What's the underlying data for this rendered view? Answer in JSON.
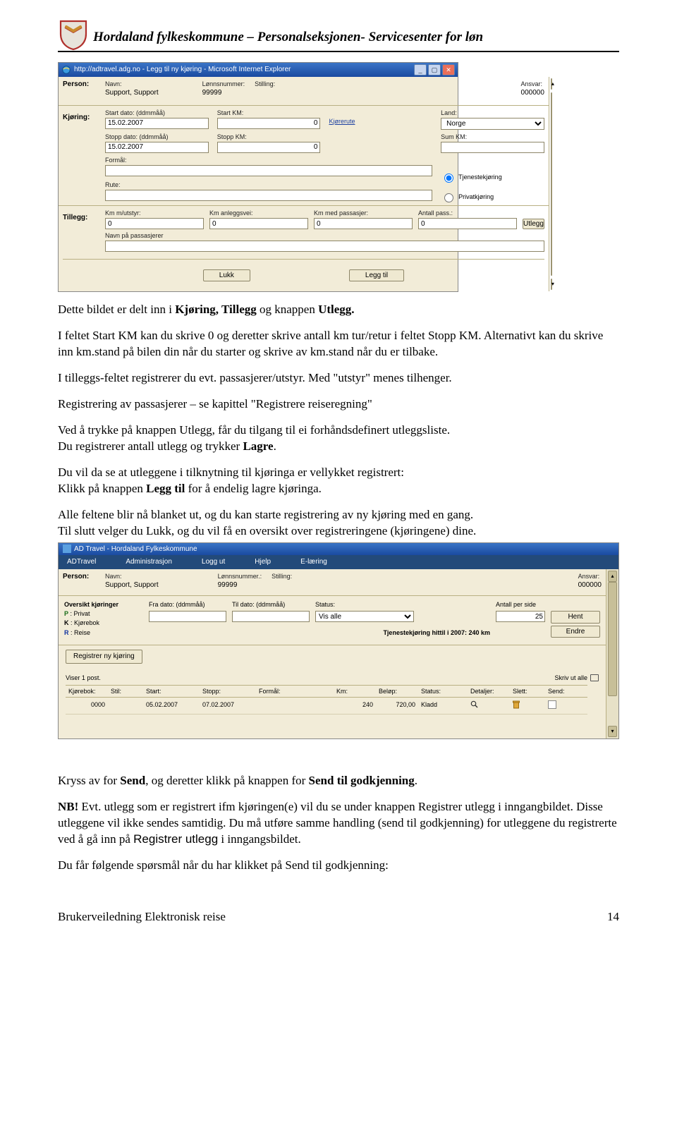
{
  "header": {
    "org_title": "Hordaland fylkeskommune – Personalseksjonen- Servicesenter for løn"
  },
  "ss1": {
    "title": "http://adtravel.adg.no - Legg til ny kjøring - Microsoft Internet Explorer",
    "person": {
      "label": "Person:",
      "navn_label": "Navn:",
      "navn_val": "Support, Support",
      "lonnsnr_label": "Lønnsnummer:",
      "lonnsnr_val": "99999",
      "stilling_label": "Stilling:",
      "stilling_val": "",
      "ansvar_label": "Ansvar:",
      "ansvar_val": "000000"
    },
    "kjoring": {
      "label": "Kjøring:",
      "start_dato_label": "Start dato: (ddmmåå)",
      "start_dato_val": "15.02.2007",
      "start_km_label": "Start KM:",
      "start_km_val": "0",
      "kjorerute_link": "Kjørerute",
      "land_label": "Land:",
      "land_val": "Norge",
      "stopp_dato_label": "Stopp dato: (ddmmåå)",
      "stopp_dato_val": "15.02.2007",
      "stopp_km_label": "Stopp KM:",
      "stopp_km_val": "0",
      "sum_km_label": "Sum KM:",
      "sum_km_val": "",
      "formal_label": "Formål:",
      "rute_label": "Rute:",
      "tjeneste_label": "Tjenestekjøring",
      "privat_label": "Privatkjøring"
    },
    "tillegg": {
      "label": "Tillegg:",
      "km_utstyr_label": "Km m/utstyr:",
      "km_utstyr_val": "0",
      "km_anlegg_label": "Km anleggsvei:",
      "km_anlegg_val": "0",
      "km_pass_label": "Km med passasjer:",
      "km_pass_val": "0",
      "antall_pass_label": "Antall pass.:",
      "antall_pass_val": "0",
      "utlegg_btn": "Utlegg",
      "navn_pass_label": "Navn på passasjerer"
    },
    "buttons": {
      "lukk": "Lukk",
      "legg_til": "Legg til"
    }
  },
  "body": {
    "p1a": "Dette bildet er delt inn i ",
    "p1b": "Kjøring, Tillegg",
    "p1c": " og knappen ",
    "p1d": "Utlegg.",
    "p2": "I feltet Start KM kan du skrive 0 og deretter skrive antall km tur/retur i feltet Stopp KM. Alternativt kan du skrive inn km.stand på bilen din når du starter og skrive av km.stand når du er tilbake.",
    "p3": "I tilleggs-feltet registrerer du evt. passasjerer/utstyr. Med \"utstyr\" menes tilhenger.",
    "p4": "Registrering av passasjerer – se kapittel \"Registrere reiseregning\"",
    "p5a": "Ved å trykke på knappen Utlegg, får du tilgang til ei forhåndsdefinert utleggsliste.",
    "p5b": "Du registrerer antall utlegg og trykker ",
    "p5c": "Lagre",
    "p5d": ".",
    "p6a": "Du vil da se at utleggene i tilknytning til kjøringa er vellykket registrert:",
    "p6b": "Klikk på knappen ",
    "p6c": "Legg til",
    "p6d": " for å endelig lagre kjøringa.",
    "p7a": "Alle feltene blir nå blanket ut, og du kan starte registrering av ny kjøring med en gang.",
    "p7b": "Til slutt velger du Lukk, og du vil få en oversikt over registreringene (kjøringene) dine.",
    "p8a": "Kryss av for ",
    "p8b": "Send",
    "p8c": ", og deretter klikk på knappen for ",
    "p8d": "Send til godkjenning",
    "p8e": ".",
    "p9a": "NB!",
    "p9b": " Evt. utlegg som er registrert ifm kjøringen(e) vil du se under knappen Registrer utlegg i inngangbildet. Disse utleggene vil ikke sendes samtidig. Du må utføre samme handling (send til godkjenning) for utleggene du registrerte ved å gå inn på ",
    "p9c": "Registrer utlegg",
    "p9d": " i inngangsbildet.",
    "p10": "Du får følgende spørsmål når du har klikket på Send til godkjenning:"
  },
  "ss2": {
    "title": "AD Travel - Hordaland Fylkeskommune",
    "menu": [
      "ADTravel",
      "Administrasjon",
      "Logg ut",
      "Hjelp",
      "E-læring"
    ],
    "person": {
      "label": "Person:",
      "navn_label": "Navn:",
      "navn_val": "Support, Support",
      "lonnsnr_label": "Lønnsnummer.:",
      "lonnsnr_val": "99999",
      "stilling_label": "Stilling:",
      "ansvar_label": "Ansvar:",
      "ansvar_val": "000000"
    },
    "legend": {
      "title": "Oversikt kjøringer",
      "p": "P : Privat",
      "k": "K : Kjørebok",
      "r": "R : Reise"
    },
    "filter": {
      "fra_label": "Fra dato: (ddmmåå)",
      "til_label": "Til dato: (ddmmåå)",
      "status_label": "Status:",
      "status_val": "Vis alle",
      "antall_label": "Antall per side",
      "antall_val": "25",
      "hent_btn": "Hent",
      "tj_label": "Tjenestekjøring hittil i 2007: 240 km",
      "endre_btn": "Endre"
    },
    "reg_btn": "Registrer ny kjøring",
    "viser": "Viser 1 post.",
    "skriv_ut": "Skriv ut alle",
    "table": {
      "headers": [
        "Kjørebok:",
        "Stil:",
        "Start:",
        "Stopp:",
        "Formål:",
        "Km:",
        "Beløp:",
        "Status:",
        "Detaljer:",
        "Slett:",
        "Send:"
      ],
      "row": {
        "kjorebok": "0000",
        "stil": "",
        "start": "05.02.2007",
        "stopp": "07.02.2007",
        "formal": "",
        "km": "240",
        "belop": "720,00",
        "status": "Kladd"
      }
    }
  },
  "footer": {
    "left": "Brukerveiledning Elektronisk reise",
    "right": "14"
  }
}
